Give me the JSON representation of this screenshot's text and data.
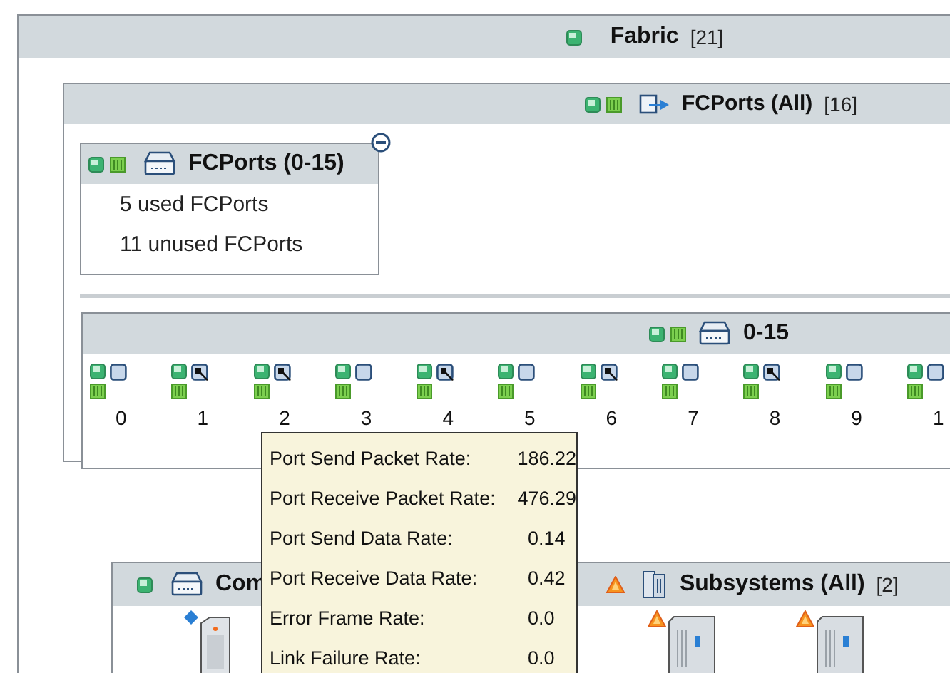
{
  "fabric": {
    "title": "Fabric",
    "count": "[21]"
  },
  "fcports_all": {
    "title": "FCPorts (All)",
    "count": "[16]"
  },
  "group_card": {
    "title": "FCPorts (0-15)",
    "lines": [
      "5 used FCPorts",
      "11 unused FCPorts"
    ]
  },
  "port_panel": {
    "title": "0-15",
    "ports": [
      {
        "label": "0",
        "monitored": false
      },
      {
        "label": "1",
        "monitored": true
      },
      {
        "label": "2",
        "monitored": true
      },
      {
        "label": "3",
        "monitored": false
      },
      {
        "label": "4",
        "monitored": true
      },
      {
        "label": "5",
        "monitored": false
      },
      {
        "label": "6",
        "monitored": true
      },
      {
        "label": "7",
        "monitored": false
      },
      {
        "label": "8",
        "monitored": true
      },
      {
        "label": "9",
        "monitored": false
      },
      {
        "label": "1",
        "monitored": false
      }
    ]
  },
  "computers": {
    "title": "Com"
  },
  "subsystems": {
    "title": "Subsystems (All)",
    "count": "[2]"
  },
  "tooltip": {
    "rows": [
      {
        "label": "Port Send Packet Rate:",
        "value": "186.22"
      },
      {
        "label": "Port Receive Packet Rate:",
        "value": "476.29"
      },
      {
        "label": "Port Send Data Rate:",
        "value": "0.14"
      },
      {
        "label": "Port Receive Data Rate:",
        "value": "0.42"
      },
      {
        "label": "Error Frame Rate:",
        "value": "0.0"
      },
      {
        "label": "Link Failure Rate:",
        "value": "0.0"
      }
    ]
  }
}
